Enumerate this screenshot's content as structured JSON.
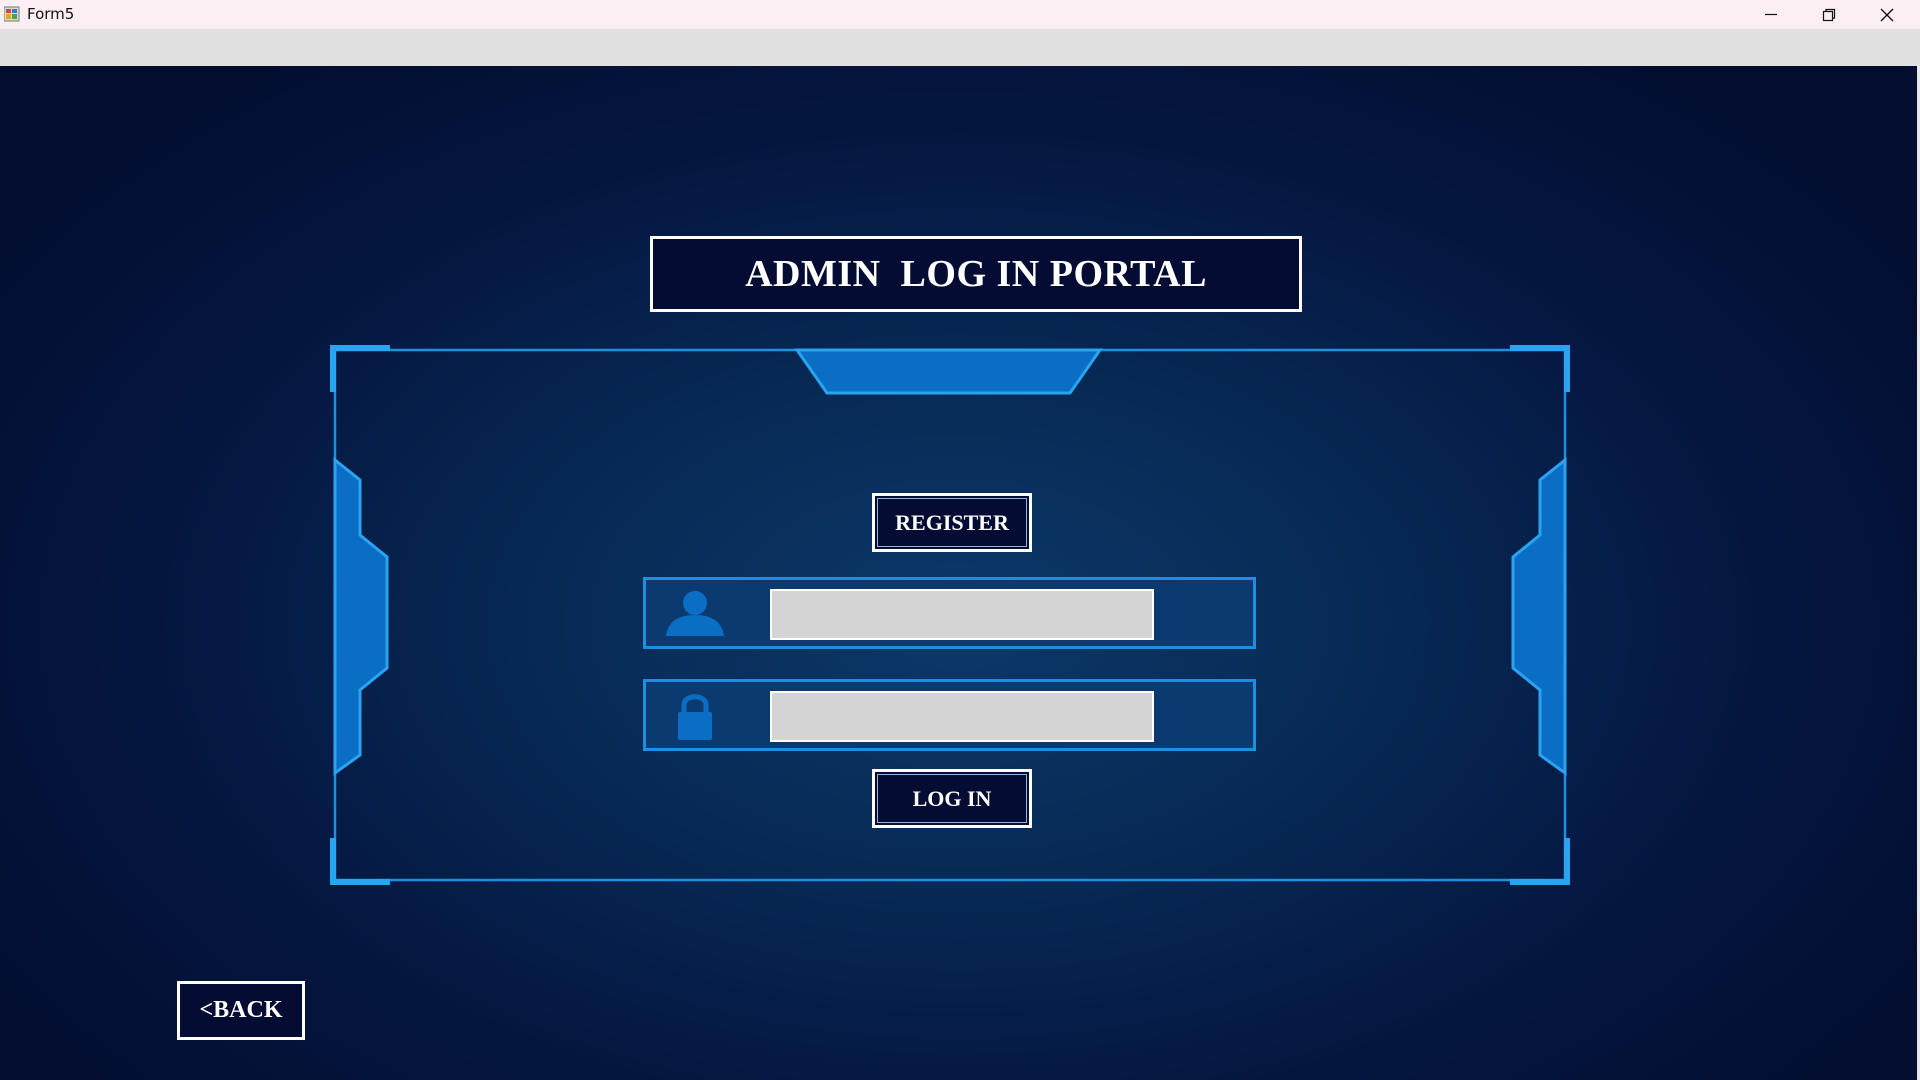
{
  "window": {
    "title": "Form5",
    "controls": [
      "minimize",
      "restore",
      "close"
    ]
  },
  "portal": {
    "title": "ADMIN  LOG IN PORTAL",
    "register_label": "REGISTER",
    "login_label": "LOG IN",
    "back_label": "<BACK"
  },
  "fields": {
    "username": {
      "icon": "user-icon",
      "value": ""
    },
    "password": {
      "icon": "lock-icon",
      "value": ""
    }
  },
  "colors": {
    "background_dark": "#030e30",
    "background_glow": "#0c3869",
    "accent": "#1d8fe0",
    "button_bg": "#040c33",
    "input_bg": "#d4d4d4"
  }
}
